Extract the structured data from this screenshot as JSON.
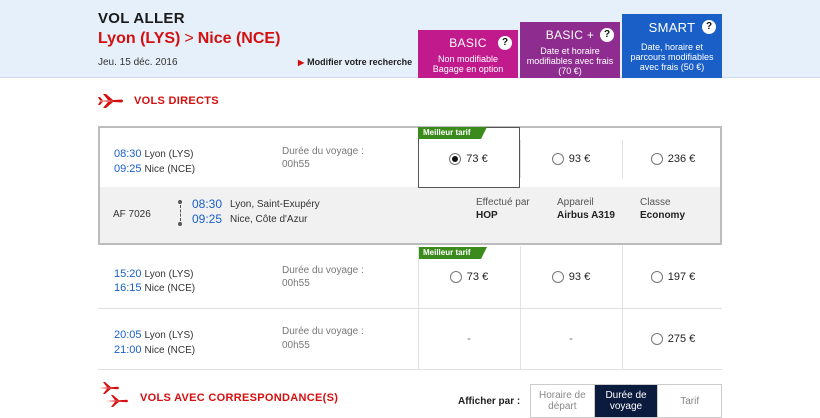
{
  "header": {
    "title": "VOL ALLER",
    "origin": "Lyon (LYS)",
    "separator": ">",
    "destination": "Nice (NCE)",
    "date": "Jeu. 15 déc. 2016",
    "modify_label": "Modifier votre recherche"
  },
  "fares": [
    {
      "name": "BASIC",
      "desc1": "Non modifiable",
      "desc2": "Bagage en option",
      "desc3": "",
      "color": "#c01a8c"
    },
    {
      "name": "BASIC +",
      "desc1": "Date et horaire",
      "desc2": "modifiables avec frais",
      "desc3": "(70 €)",
      "color": "#8e2d8f"
    },
    {
      "name": "SMART",
      "desc1": "Date, horaire et",
      "desc2": "parcours modifiables",
      "desc3": "avec frais (50 €)",
      "color": "#1a5fc8"
    }
  ],
  "help_glyph": "?",
  "sections": {
    "direct": "VOLS DIRECTS",
    "connecting": "VOLS AVEC CORRESPONDANCE(S)"
  },
  "best_fare_label": "Meilleur tarif",
  "duration_label": "Durée du voyage :",
  "flights": [
    {
      "dep_time": "08:30",
      "dep_city": "Lyon (LYS)",
      "arr_time": "09:25",
      "arr_city": "Nice (NCE)",
      "duration": "00h55",
      "prices": [
        "73 €",
        "93 €",
        "236 €"
      ],
      "details": {
        "flight_no": "AF 7026",
        "dep_time": "08:30",
        "dep_airport": "Lyon, Saint-Exupéry",
        "arr_time": "09:25",
        "arr_airport": "Nice, Côte d'Azur",
        "operated_label": "Effectué par",
        "operated": "HOP",
        "aircraft_label": "Appareil",
        "aircraft": "Airbus A319",
        "class_label": "Classe",
        "class": "Economy"
      }
    },
    {
      "dep_time": "15:20",
      "dep_city": "Lyon (LYS)",
      "arr_time": "16:15",
      "arr_city": "Nice (NCE)",
      "duration": "00h55",
      "prices": [
        "73 €",
        "93 €",
        "197 €"
      ]
    },
    {
      "dep_time": "20:05",
      "dep_city": "Lyon (LYS)",
      "arr_time": "21:00",
      "arr_city": "Nice (NCE)",
      "duration": "00h55",
      "prices": [
        "-",
        "-",
        "275 €"
      ]
    }
  ],
  "sort": {
    "label": "Afficher par :",
    "options": [
      {
        "line1": "Horaire de",
        "line2": "départ"
      },
      {
        "line1": "Durée de",
        "line2": "voyage"
      },
      {
        "line1": "Tarif",
        "line2": ""
      }
    ],
    "active": "Durée de voyage"
  }
}
